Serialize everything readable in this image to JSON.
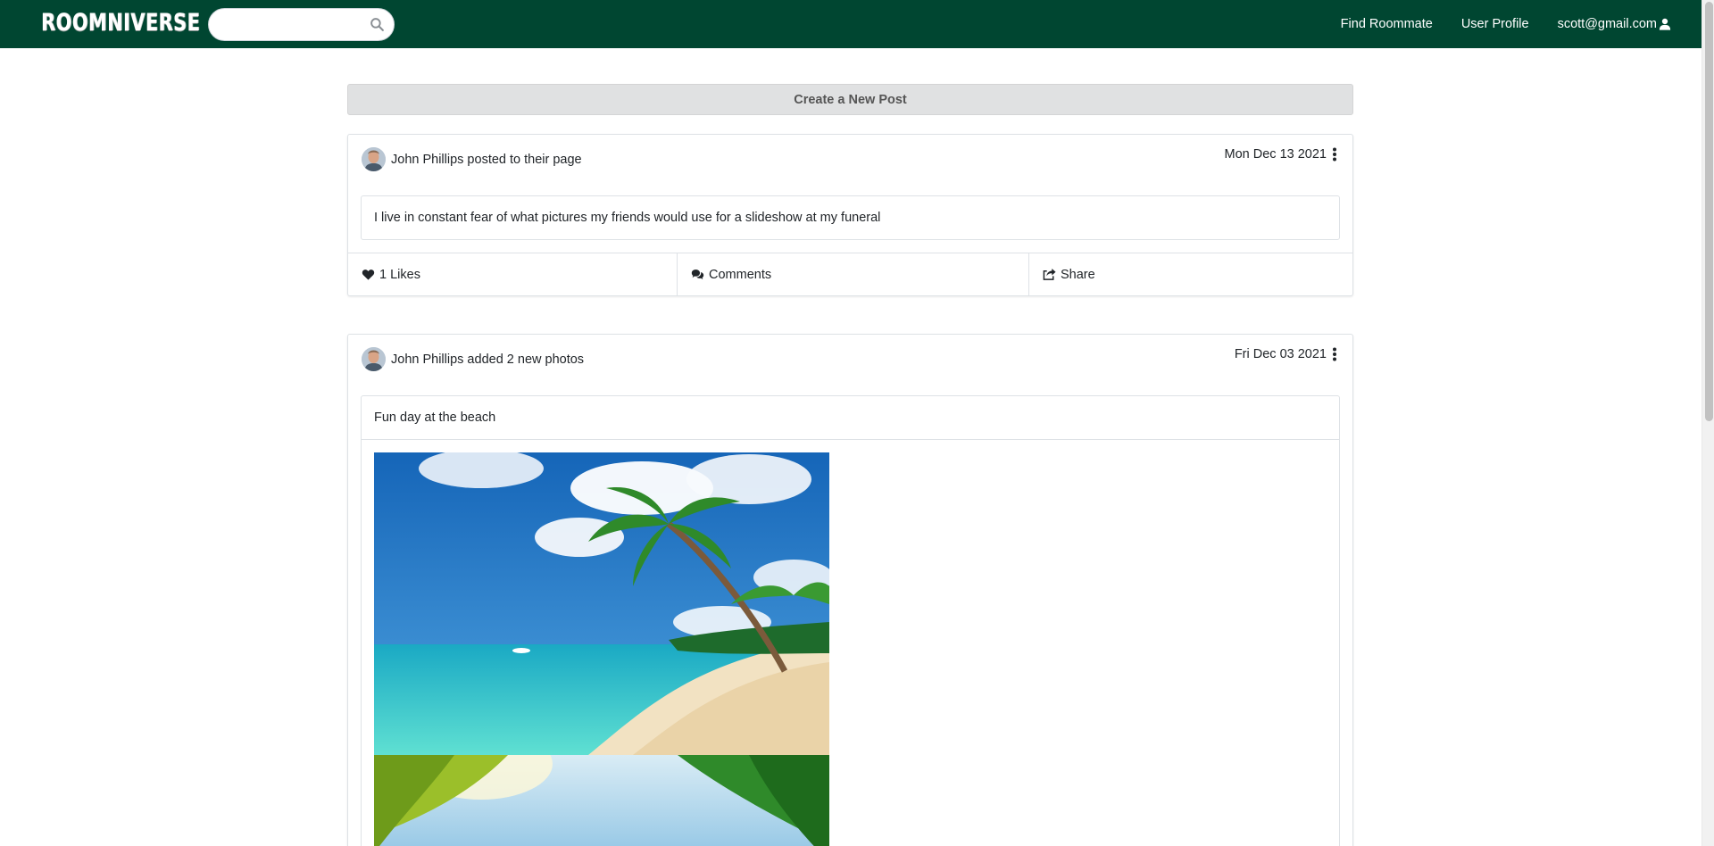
{
  "app": {
    "logo_text": "ROOMNIVERSE"
  },
  "search": {
    "placeholder": "",
    "value": ""
  },
  "nav": {
    "find_roommate": "Find Roommate",
    "user_profile": "User Profile",
    "user_email": "scott@gmail.com"
  },
  "create_post_label": "Create a New Post",
  "posts": [
    {
      "author_line": "John Phillips posted to their page",
      "date": "Mon Dec 13 2021",
      "text": "I live in constant fear of what pictures my friends would use for a slideshow at my funeral",
      "likes_label": "1 Likes",
      "comments_label": "Comments",
      "share_label": "Share"
    },
    {
      "author_line": "John Phillips added 2 new photos",
      "date": "Fri Dec 03 2021",
      "text": "Fun day at the beach"
    }
  ],
  "colors": {
    "navbar": "#004631",
    "create_post_bg": "#e0e1e2"
  },
  "icons": [
    "search-icon",
    "user-icon",
    "kebab-icon",
    "heart-icon",
    "comments-icon",
    "share-icon"
  ]
}
